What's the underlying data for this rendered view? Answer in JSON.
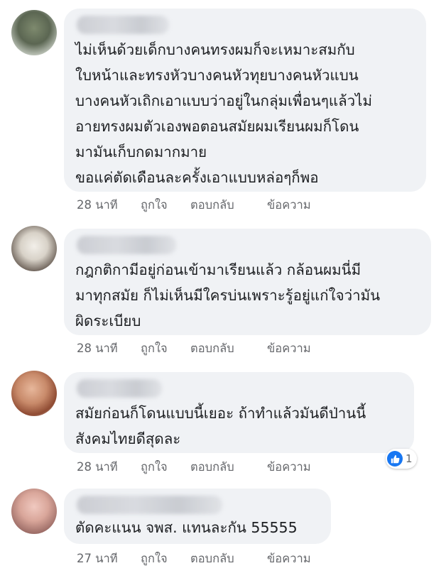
{
  "comments": [
    {
      "text": "ไม่เห็นด้วยเด็กบางคนทรงผมก็จะเหมาะสมกับ\nใบหน้าและทรงหัวบางคนหัวทุยบางคนหัวแบน\nบางคนหัวเถิกเอาแบบว่าอยู่ในกลุ่มเพื่อนๆแล้วไม่\nอายทรงผมตัวเองพอตอนสมัยผมเรียนผมก็โดน\nมามันเก็บกดมากมาย\nขอแค่ตัดเดือนละครั้งเอาแบบหล่อๆก็พอ",
      "time": "28 นาที",
      "like": "ถูกใจ",
      "reply": "ตอบกลับ",
      "message": "ข้อความ"
    },
    {
      "text": "กฎกติกามีอยู่ก่อนเข้ามาเรียนแล้ว กล้อนผมนี่มี\nมาทุกสมัย ก็ไม่เห็นมีใครบ่นเพราะรู้อยู่แก่ใจว่ามัน\nผิดระเบียบ",
      "time": "28 นาที",
      "like": "ถูกใจ",
      "reply": "ตอบกลับ",
      "message": "ข้อความ"
    },
    {
      "text": "สมัยก่อนก็โดนแบบนี้เยอะ ถ้าทำแล้วมันดีป่านนี้\nสังคมไทยดีสุดละ",
      "time": "28 นาที",
      "like": "ถูกใจ",
      "reply": "ตอบกลับ",
      "message": "ข้อความ",
      "reaction_count": "1",
      "reaction_icon": "thumbs-up-icon"
    },
    {
      "text": "ตัดคะแนน จพส. แทนละกัน 55555",
      "time": "27 นาที",
      "like": "ถูกใจ",
      "reply": "ตอบกลับ",
      "message": "ข้อความ"
    }
  ],
  "colors": {
    "bubble": "#f0f2f5",
    "text": "#1c1e21",
    "meta": "#65676b",
    "like_blue": "#1877f2"
  }
}
